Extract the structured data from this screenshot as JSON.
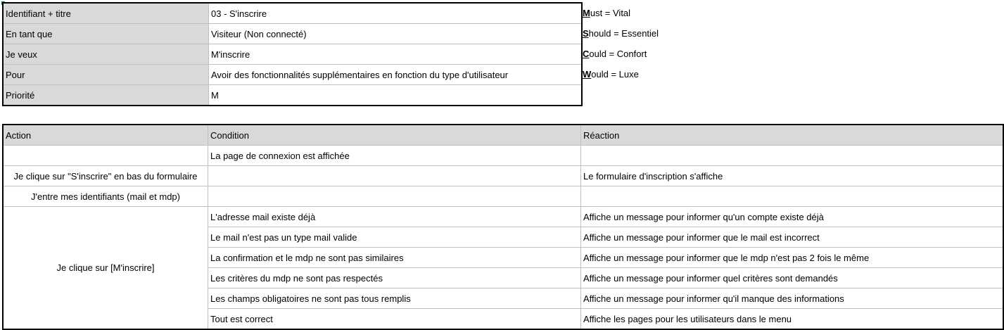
{
  "story": {
    "rows": [
      {
        "label": "Identifiant + titre",
        "value": "03 - S'inscrire"
      },
      {
        "label": "En tant que",
        "value": "Visiteur (Non connecté)"
      },
      {
        "label": "Je veux",
        "value": "M'inscrire"
      },
      {
        "label": "Pour",
        "value": "Avoir des fonctionnalités supplémentaires en fonction du type d'utilisateur"
      },
      {
        "label": "Priorité",
        "value": "M"
      }
    ]
  },
  "legend": [
    {
      "key": "M",
      "rest": "ust = Vital"
    },
    {
      "key": "S",
      "rest": "hould = Essentiel"
    },
    {
      "key": "C",
      "rest": "ould = Confort"
    },
    {
      "key": "W",
      "rest": "ould = Luxe"
    }
  ],
  "acceptance": {
    "headers": [
      "Action",
      "Condition",
      "Réaction"
    ],
    "actions": [
      "Je clique sur \"S'inscrire\" en bas du formulaire",
      "J'entre mes identifiants (mail et mdp)",
      "Je clique sur [M'inscrire]"
    ],
    "initial_condition": "La page de connexion est affichée",
    "reaction_form": "Le formulaire d'inscription s'affiche",
    "conditions": [
      {
        "condition": "L'adresse mail existe déjà",
        "reaction": "Affiche un message pour informer qu'un compte existe déjà"
      },
      {
        "condition": "Le mail n'est pas un type mail valide",
        "reaction": "Affiche un message pour informer que le mail est incorrect"
      },
      {
        "condition": "La confirmation et le mdp ne sont pas similaires",
        "reaction": "Affiche un message pour informer que le mdp n'est pas 2 fois le même"
      },
      {
        "condition": "Les critères du mdp ne sont pas respectés",
        "reaction": "Affiche un message pour informer quel critères sont demandés"
      },
      {
        "condition": "Les champs obligatoires ne sont pas tous remplis",
        "reaction": "Affiche un message pour informer qu'il manque des informations"
      },
      {
        "condition": "Tout est correct",
        "reaction": "Affiche les pages pour les utilisateurs dans le menu"
      }
    ]
  },
  "colors": {
    "header_fill": "#d9d9d9",
    "grid": "#bfbfbf",
    "border": "#000000",
    "selection_marker": "#217346"
  }
}
